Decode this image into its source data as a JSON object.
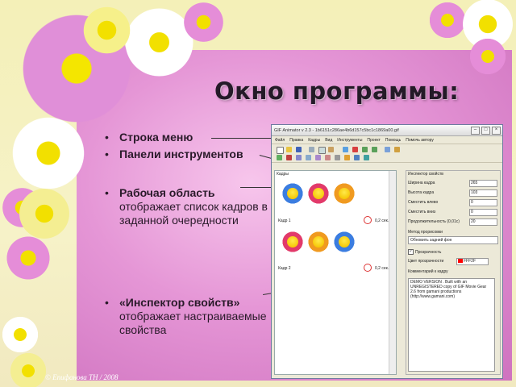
{
  "slide": {
    "title": "Окно программы:",
    "copyright": "© Епифанова ТН / 2008",
    "bullets": [
      {
        "bold": "Строка меню",
        "sub": ""
      },
      {
        "bold": "Панели инструментов",
        "sub": ""
      },
      {
        "bold": "Рабочая область",
        "sub": "отображает список кадров в заданной очередности"
      },
      {
        "bold": "«Инспектор свойств»",
        "sub": "отображает настраиваемые свойства"
      }
    ]
  },
  "app_window": {
    "title": "GIF Animator v 2.3 - 1b6151c286ae4b6d157c5bc1c1869a00.gif",
    "menu": [
      "Файл",
      "Правка",
      "Кадры",
      "Вид",
      "Инструменты",
      "Проект",
      "Помощь",
      "Помочь автору"
    ],
    "frames_panel": {
      "header": "Кадры",
      "frames": [
        {
          "label": "Кадр 1",
          "delay": "0,2 сек."
        },
        {
          "label": "Кадр 2",
          "delay": "0,2 сек."
        }
      ]
    },
    "inspector": {
      "header": "Инспектор свойств",
      "rows": [
        {
          "label": "Ширина кадра",
          "value": "265"
        },
        {
          "label": "Высота кадра",
          "value": "103"
        },
        {
          "label": "Сместить влево",
          "value": "0"
        },
        {
          "label": "Сместить вниз",
          "value": "0"
        },
        {
          "label": "Продолжительность (0,01с)",
          "value": "20"
        }
      ],
      "method_label": "Метод прорисовки",
      "method_value": "Обновить задний фон",
      "transparency_label": "Прозрачность",
      "transparency_color_label": "Цвет прозрачности",
      "transparency_color_value": "FFF2F",
      "comment_label": "Комментарий к кадру",
      "comment_text": "DEMO VERSION . Built with an UNREGISTERED copy of GIF Movie Gear 2.6 from gamani productions (http://www.gamani.com)"
    }
  }
}
